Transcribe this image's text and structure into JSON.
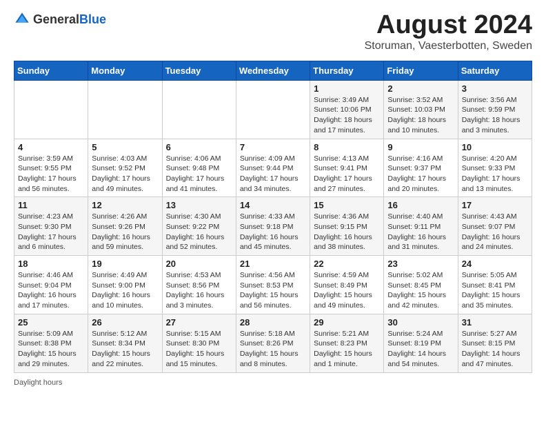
{
  "header": {
    "logo_general": "General",
    "logo_blue": "Blue",
    "title": "August 2024",
    "subtitle": "Storuman, Vaesterbotten, Sweden"
  },
  "footer": {
    "daylight_label": "Daylight hours"
  },
  "weekdays": [
    "Sunday",
    "Monday",
    "Tuesday",
    "Wednesday",
    "Thursday",
    "Friday",
    "Saturday"
  ],
  "weeks": [
    [
      {
        "day": "",
        "info": ""
      },
      {
        "day": "",
        "info": ""
      },
      {
        "day": "",
        "info": ""
      },
      {
        "day": "",
        "info": ""
      },
      {
        "day": "1",
        "info": "Sunrise: 3:49 AM\nSunset: 10:06 PM\nDaylight: 18 hours\nand 17 minutes."
      },
      {
        "day": "2",
        "info": "Sunrise: 3:52 AM\nSunset: 10:03 PM\nDaylight: 18 hours\nand 10 minutes."
      },
      {
        "day": "3",
        "info": "Sunrise: 3:56 AM\nSunset: 9:59 PM\nDaylight: 18 hours\nand 3 minutes."
      }
    ],
    [
      {
        "day": "4",
        "info": "Sunrise: 3:59 AM\nSunset: 9:55 PM\nDaylight: 17 hours\nand 56 minutes."
      },
      {
        "day": "5",
        "info": "Sunrise: 4:03 AM\nSunset: 9:52 PM\nDaylight: 17 hours\nand 49 minutes."
      },
      {
        "day": "6",
        "info": "Sunrise: 4:06 AM\nSunset: 9:48 PM\nDaylight: 17 hours\nand 41 minutes."
      },
      {
        "day": "7",
        "info": "Sunrise: 4:09 AM\nSunset: 9:44 PM\nDaylight: 17 hours\nand 34 minutes."
      },
      {
        "day": "8",
        "info": "Sunrise: 4:13 AM\nSunset: 9:41 PM\nDaylight: 17 hours\nand 27 minutes."
      },
      {
        "day": "9",
        "info": "Sunrise: 4:16 AM\nSunset: 9:37 PM\nDaylight: 17 hours\nand 20 minutes."
      },
      {
        "day": "10",
        "info": "Sunrise: 4:20 AM\nSunset: 9:33 PM\nDaylight: 17 hours\nand 13 minutes."
      }
    ],
    [
      {
        "day": "11",
        "info": "Sunrise: 4:23 AM\nSunset: 9:30 PM\nDaylight: 17 hours\nand 6 minutes."
      },
      {
        "day": "12",
        "info": "Sunrise: 4:26 AM\nSunset: 9:26 PM\nDaylight: 16 hours\nand 59 minutes."
      },
      {
        "day": "13",
        "info": "Sunrise: 4:30 AM\nSunset: 9:22 PM\nDaylight: 16 hours\nand 52 minutes."
      },
      {
        "day": "14",
        "info": "Sunrise: 4:33 AM\nSunset: 9:18 PM\nDaylight: 16 hours\nand 45 minutes."
      },
      {
        "day": "15",
        "info": "Sunrise: 4:36 AM\nSunset: 9:15 PM\nDaylight: 16 hours\nand 38 minutes."
      },
      {
        "day": "16",
        "info": "Sunrise: 4:40 AM\nSunset: 9:11 PM\nDaylight: 16 hours\nand 31 minutes."
      },
      {
        "day": "17",
        "info": "Sunrise: 4:43 AM\nSunset: 9:07 PM\nDaylight: 16 hours\nand 24 minutes."
      }
    ],
    [
      {
        "day": "18",
        "info": "Sunrise: 4:46 AM\nSunset: 9:04 PM\nDaylight: 16 hours\nand 17 minutes."
      },
      {
        "day": "19",
        "info": "Sunrise: 4:49 AM\nSunset: 9:00 PM\nDaylight: 16 hours\nand 10 minutes."
      },
      {
        "day": "20",
        "info": "Sunrise: 4:53 AM\nSunset: 8:56 PM\nDaylight: 16 hours\nand 3 minutes."
      },
      {
        "day": "21",
        "info": "Sunrise: 4:56 AM\nSunset: 8:53 PM\nDaylight: 15 hours\nand 56 minutes."
      },
      {
        "day": "22",
        "info": "Sunrise: 4:59 AM\nSunset: 8:49 PM\nDaylight: 15 hours\nand 49 minutes."
      },
      {
        "day": "23",
        "info": "Sunrise: 5:02 AM\nSunset: 8:45 PM\nDaylight: 15 hours\nand 42 minutes."
      },
      {
        "day": "24",
        "info": "Sunrise: 5:05 AM\nSunset: 8:41 PM\nDaylight: 15 hours\nand 35 minutes."
      }
    ],
    [
      {
        "day": "25",
        "info": "Sunrise: 5:09 AM\nSunset: 8:38 PM\nDaylight: 15 hours\nand 29 minutes."
      },
      {
        "day": "26",
        "info": "Sunrise: 5:12 AM\nSunset: 8:34 PM\nDaylight: 15 hours\nand 22 minutes."
      },
      {
        "day": "27",
        "info": "Sunrise: 5:15 AM\nSunset: 8:30 PM\nDaylight: 15 hours\nand 15 minutes."
      },
      {
        "day": "28",
        "info": "Sunrise: 5:18 AM\nSunset: 8:26 PM\nDaylight: 15 hours\nand 8 minutes."
      },
      {
        "day": "29",
        "info": "Sunrise: 5:21 AM\nSunset: 8:23 PM\nDaylight: 15 hours\nand 1 minute."
      },
      {
        "day": "30",
        "info": "Sunrise: 5:24 AM\nSunset: 8:19 PM\nDaylight: 14 hours\nand 54 minutes."
      },
      {
        "day": "31",
        "info": "Sunrise: 5:27 AM\nSunset: 8:15 PM\nDaylight: 14 hours\nand 47 minutes."
      }
    ]
  ]
}
